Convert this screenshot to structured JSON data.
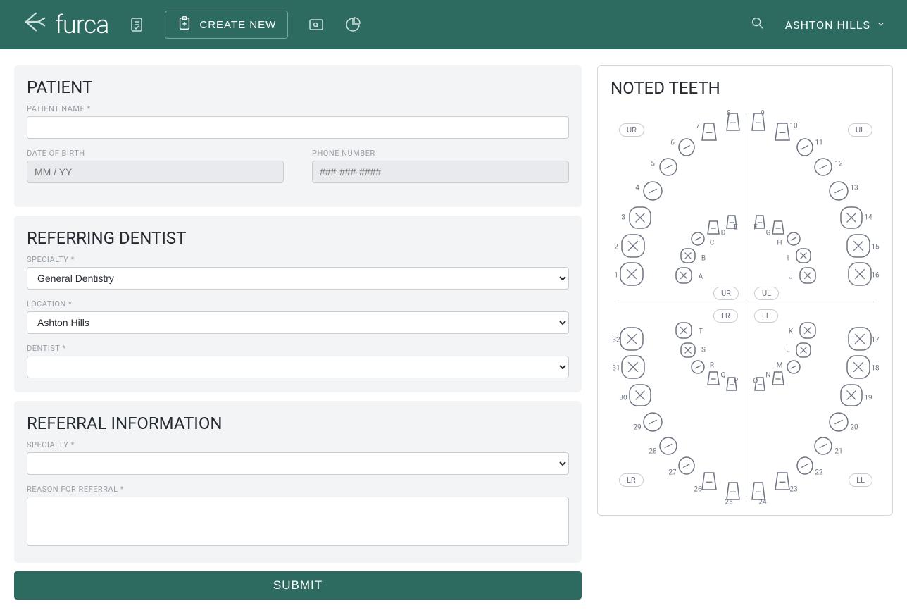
{
  "header": {
    "logo_text": "furca",
    "create_new_label": "CREATE NEW",
    "user_name": "ASHTON HILLS"
  },
  "patient_section": {
    "heading": "PATIENT",
    "name_label": "PATIENT NAME *",
    "dob_label": "DATE OF BIRTH",
    "dob_placeholder": "MM / YY",
    "phone_label": "PHONE NUMBER",
    "phone_placeholder": "###-###-####"
  },
  "referring_section": {
    "heading": "REFERRING DENTIST",
    "specialty_label": "SPECIALTY *",
    "specialty_value": "General Dentistry",
    "location_label": "LOCATION *",
    "location_value": "Ashton Hills",
    "dentist_label": "DENTIST *",
    "dentist_value": ""
  },
  "referral_info_section": {
    "heading": "REFERRAL INFORMATION",
    "specialty_label": "SPECIALTY *",
    "specialty_value": "",
    "reason_label": "REASON FOR REFERRAL *",
    "reason_value": ""
  },
  "submit_label": "SUBMIT",
  "teeth_section": {
    "heading": "NOTED TEETH",
    "quadrants": {
      "ur": "UR",
      "ul": "UL",
      "lr": "LR",
      "ll": "LL"
    },
    "upper_teeth": [
      "1",
      "2",
      "3",
      "4",
      "5",
      "6",
      "7",
      "8",
      "9",
      "10",
      "11",
      "12",
      "13",
      "14",
      "15",
      "16"
    ],
    "upper_primary": [
      "A",
      "B",
      "C",
      "D",
      "E",
      "F",
      "G",
      "H",
      "I",
      "J"
    ],
    "lower_teeth": [
      "17",
      "18",
      "19",
      "20",
      "21",
      "22",
      "23",
      "24",
      "25",
      "26",
      "27",
      "28",
      "29",
      "30",
      "31",
      "32"
    ],
    "lower_primary": [
      "K",
      "L",
      "M",
      "N",
      "O",
      "P",
      "Q",
      "R",
      "S",
      "T"
    ]
  }
}
